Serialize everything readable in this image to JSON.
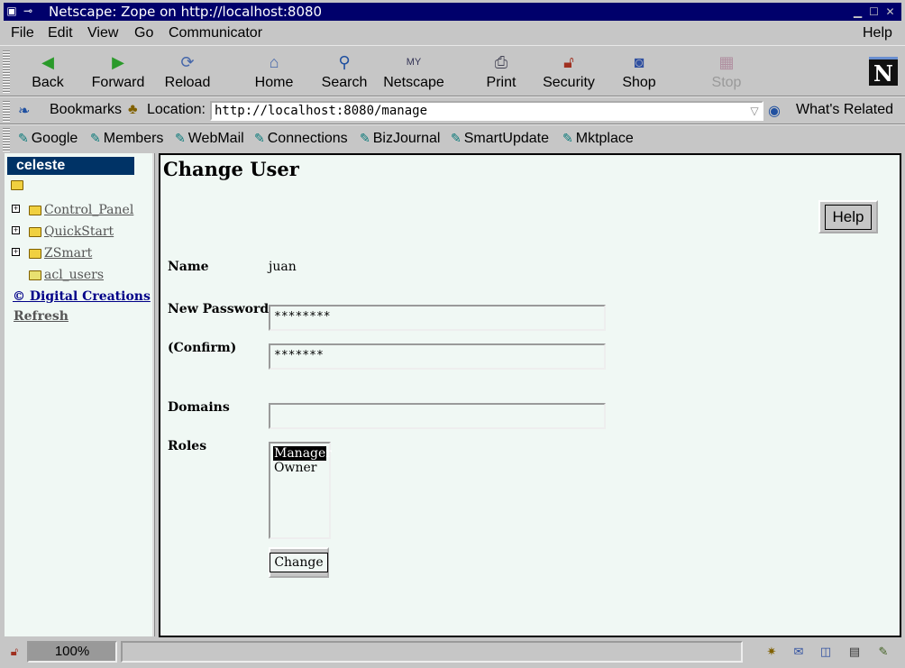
{
  "window": {
    "title": "Netscape: Zope on http://localhost:8080",
    "controls": [
      "minimize-icon",
      "maximize-icon",
      "close-icon"
    ]
  },
  "menubar": {
    "items": [
      "File",
      "Edit",
      "View",
      "Go",
      "Communicator"
    ],
    "help": "Help"
  },
  "toolbar": {
    "buttons": [
      {
        "label": "Back",
        "icon": "back-arrow-icon"
      },
      {
        "label": "Forward",
        "icon": "forward-arrow-icon"
      },
      {
        "label": "Reload",
        "icon": "reload-icon"
      },
      {
        "label": "Home",
        "icon": "home-icon"
      },
      {
        "label": "Search",
        "icon": "search-icon"
      },
      {
        "label": "Netscape",
        "icon": "my-netscape-icon"
      },
      {
        "label": "Print",
        "icon": "printer-icon"
      },
      {
        "label": "Security",
        "icon": "padlock-icon"
      },
      {
        "label": "Shop",
        "icon": "shop-icon"
      },
      {
        "label": "Stop",
        "icon": "stop-icon",
        "disabled": true
      }
    ]
  },
  "locationbar": {
    "bookmarks_label": "Bookmarks",
    "location_label": "Location:",
    "url": "http://localhost:8080/manage",
    "whats_related": "What's Related"
  },
  "personal_toolbar": {
    "items": [
      "Google",
      "Members",
      "WebMail",
      "Connections",
      "BizJournal",
      "SmartUpdate",
      "Mktplace"
    ]
  },
  "left_frame": {
    "header": "celeste",
    "tree": [
      {
        "label": "Control_Panel",
        "icon": "control-panel-folder-icon",
        "expandable": true
      },
      {
        "label": "QuickStart",
        "icon": "folder-icon",
        "expandable": true
      },
      {
        "label": "ZSmart",
        "icon": "folder-icon",
        "expandable": true
      },
      {
        "label": "acl_users",
        "icon": "user-folder-icon",
        "expandable": false
      }
    ],
    "copyright_link": "© Digital Creations",
    "refresh_link": "Refresh"
  },
  "main": {
    "title": "Change User",
    "help_button": "Help",
    "form": {
      "name_label": "Name",
      "name_value": "juan",
      "password_label": "New Password",
      "password_value": "********",
      "confirm_label": "(Confirm)",
      "confirm_value": "*******",
      "domains_label": "Domains",
      "domains_value": "",
      "roles_label": "Roles",
      "roles_options": [
        "Manager",
        "Owner"
      ],
      "roles_selected": "Manager",
      "submit_label": "Change"
    }
  },
  "statusbar": {
    "zoom": "100%"
  },
  "colors": {
    "titlebar": "#00006b",
    "left_header": "#003366",
    "page_background": "#f0f8f4",
    "chrome": "#c6c6c6"
  }
}
